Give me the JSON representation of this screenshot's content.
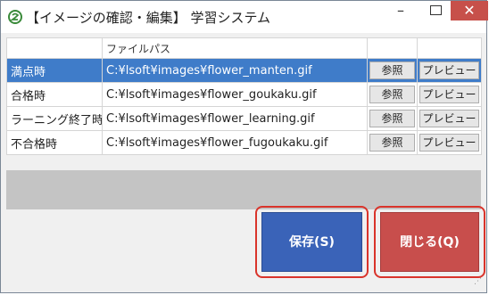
{
  "window": {
    "title": "【イメージの確認・編集】 学習システム",
    "minimize_label": "–",
    "close_label": "✕",
    "icon": "app-icon"
  },
  "table": {
    "headers": [
      "",
      "ファイルパス",
      "",
      ""
    ],
    "rows": [
      {
        "label": "満点時",
        "path": "C:¥lsoft¥images¥flower_manten.gif",
        "browse": "参照",
        "preview": "プレビュー",
        "selected": true
      },
      {
        "label": "合格時",
        "path": "C:¥lsoft¥images¥flower_goukaku.gif",
        "browse": "参照",
        "preview": "プレビュー",
        "selected": false
      },
      {
        "label": "ラーニング終了時",
        "path": "C:¥lsoft¥images¥flower_learning.gif",
        "browse": "参照",
        "preview": "プレビュー",
        "selected": false
      },
      {
        "label": "不合格時",
        "path": "C:¥lsoft¥images¥flower_fugoukaku.gif",
        "browse": "参照",
        "preview": "プレビュー",
        "selected": false
      }
    ]
  },
  "actions": {
    "save_label": "保存(S)",
    "close_label": "閉じる(Q)"
  },
  "colors": {
    "selection": "#3f7cc9",
    "save": "#3a63b8",
    "close": "#c84e4c",
    "highlight": "#d9342b"
  }
}
